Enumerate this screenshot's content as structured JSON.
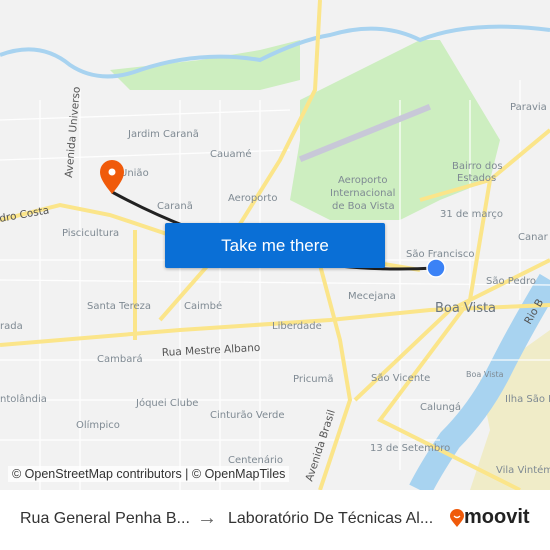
{
  "map": {
    "labels": {
      "jardim_carana": "Jardim Caranã",
      "cauame": "Cauamé",
      "uniao": "União",
      "carana": "Caranã",
      "aeroporto": "Aeroporto",
      "airport1": "Aeroporto",
      "airport2": "Internacional",
      "airport3": "de Boa Vista",
      "bairro1": "Bairro dos",
      "bairro2": "Estados",
      "trinta_e_um": "31 de março",
      "paraviana": "Paravia",
      "canarinho": "Canar",
      "sao_francisco": "São Francisco",
      "sao_pedro": "São Pedro",
      "piscicultura": "Piscicultura",
      "santa_tereza": "Santa Tereza",
      "caimbe": "Caimbé",
      "mecejana": "Mecejana",
      "boa_vista": "Boa Vista",
      "boa_vista_small": "Boa Vista",
      "liberdade": "Liberdade",
      "cambara": "Cambará",
      "rua_mestre_albano": "Rua Mestre Albano",
      "pricuma": "Pricumã",
      "sao_vicente": "São Vicente",
      "joquei": "Jóquei Clube",
      "cinturao": "Cinturão Verde",
      "olimpico": "Olímpico",
      "antolandia": "ntolândia",
      "calunga": "Calungá",
      "ilha": "Ilha São Pe",
      "treze": "13 de Setembro",
      "centenario": "Centenário",
      "vila": "Vila Vintém",
      "avenida_brasil": "Avenida Brasil",
      "avenida_universo": "Avenida Universo",
      "pedro_costa": "dro Costa",
      "rio": "Rio B",
      "dorada": "rada"
    },
    "colors": {
      "route": "#222222",
      "origin": "#3b82f6",
      "destination": "#f05a0a",
      "water": "#a8d3f0",
      "park": "#cdeec0",
      "road": "#fbe58a"
    }
  },
  "cta": {
    "label": "Take me there"
  },
  "attribution": "© OpenStreetMap contributors | © OpenMapTiles",
  "footer": {
    "from": "Rua General Penha B...",
    "arrow": "→",
    "to": "Laboratório De Técnicas Al...",
    "brand": "moovit"
  }
}
